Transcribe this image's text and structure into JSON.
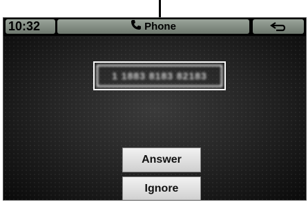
{
  "status_bar": {
    "time": "10:32",
    "title": "Phone",
    "phone_icon": "phone-handset-icon",
    "back_icon": "back-arrow-icon"
  },
  "call": {
    "caller_number": "1 1883 8183 82183"
  },
  "actions": {
    "answer_label": "Answer",
    "ignore_label": "Ignore"
  }
}
